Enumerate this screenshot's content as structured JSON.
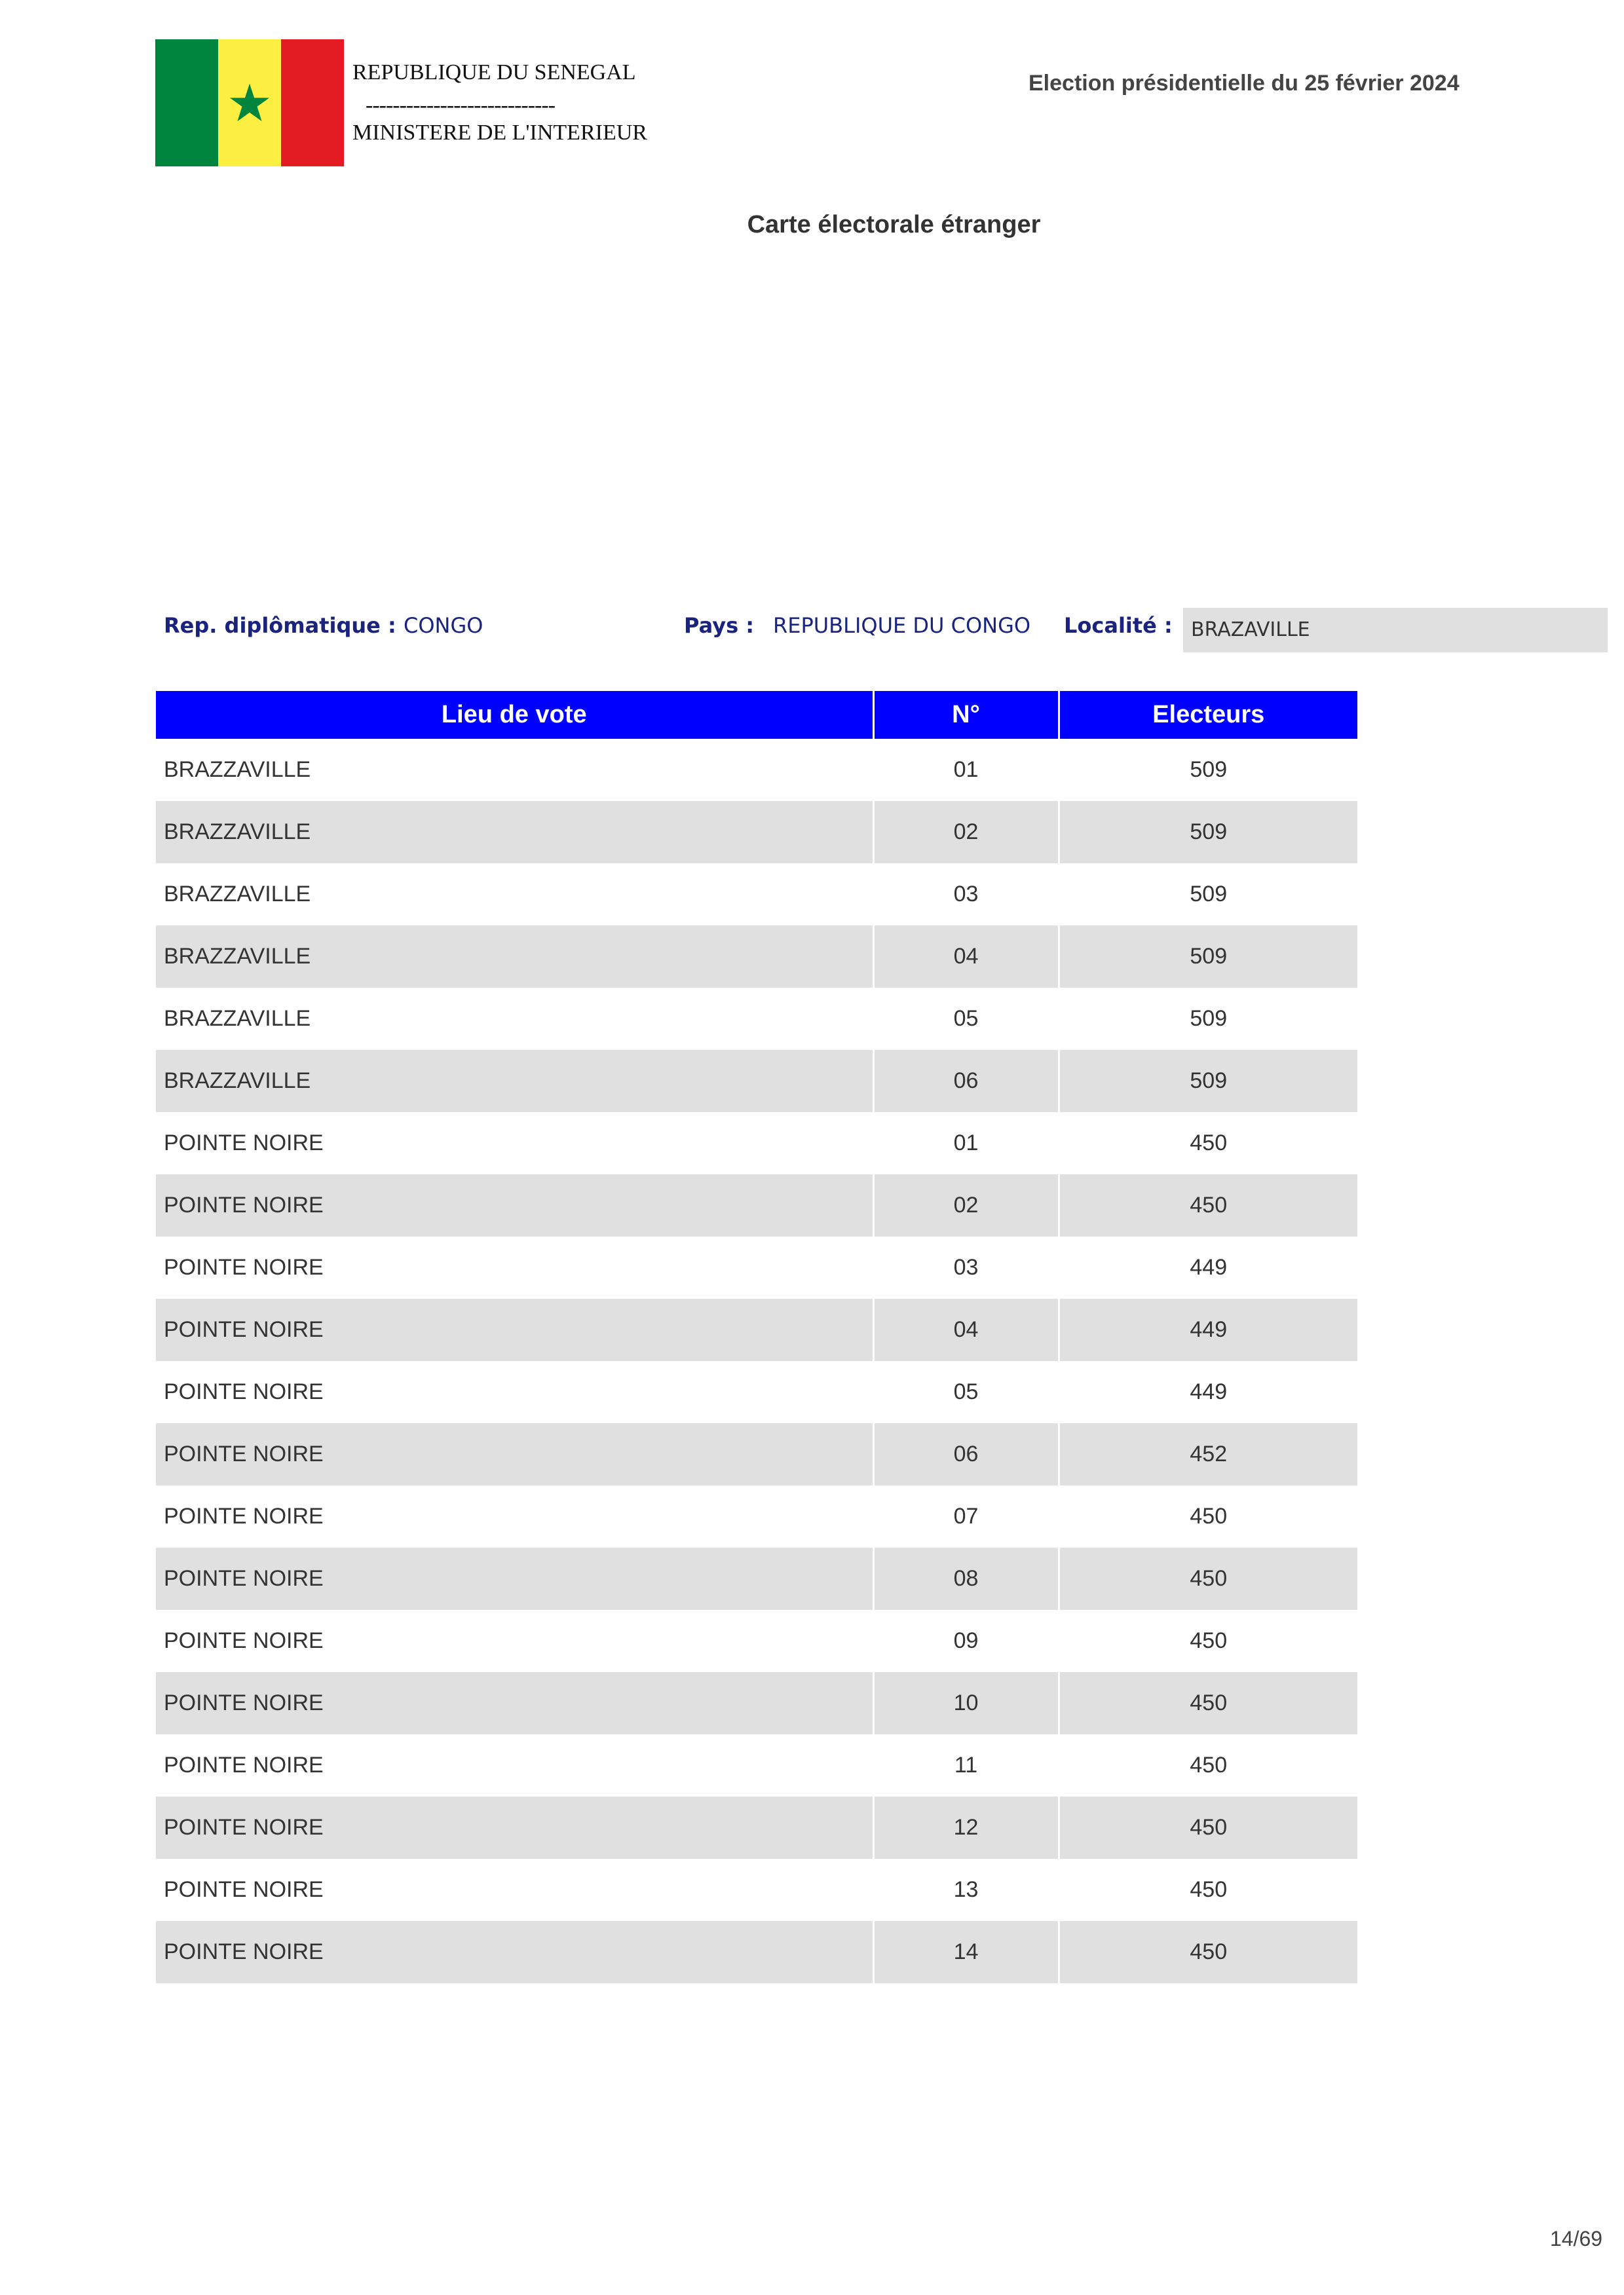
{
  "header": {
    "republic": "REPUBLIQUE DU SENEGAL",
    "separator": "----------------------------",
    "ministry": "MINISTERE DE L'INTERIEUR",
    "election": "Election présidentielle du 25 février 2024",
    "flag_colors": [
      "#00853f",
      "#fdef42",
      "#e31b23"
    ]
  },
  "document_title": "Carte électorale étranger",
  "info": {
    "rep_label": "Rep. diplômatique :",
    "rep_value": "CONGO",
    "pays_label": "Pays :",
    "pays_value": "REPUBLIQUE DU CONGO",
    "localite_label": "Localité :",
    "localite_value": "BRAZAVILLE"
  },
  "table": {
    "headers": [
      "Lieu de vote",
      "N°",
      "Electeurs"
    ],
    "rows": [
      {
        "lieu": "BRAZZAVILLE",
        "num": "01",
        "electeurs": "509"
      },
      {
        "lieu": "BRAZZAVILLE",
        "num": "02",
        "electeurs": "509"
      },
      {
        "lieu": "BRAZZAVILLE",
        "num": "03",
        "electeurs": "509"
      },
      {
        "lieu": "BRAZZAVILLE",
        "num": "04",
        "electeurs": "509"
      },
      {
        "lieu": "BRAZZAVILLE",
        "num": "05",
        "electeurs": "509"
      },
      {
        "lieu": "BRAZZAVILLE",
        "num": "06",
        "electeurs": "509"
      },
      {
        "lieu": "POINTE NOIRE",
        "num": "01",
        "electeurs": "450"
      },
      {
        "lieu": "POINTE NOIRE",
        "num": "02",
        "electeurs": "450"
      },
      {
        "lieu": "POINTE NOIRE",
        "num": "03",
        "electeurs": "449"
      },
      {
        "lieu": "POINTE NOIRE",
        "num": "04",
        "electeurs": "449"
      },
      {
        "lieu": "POINTE NOIRE",
        "num": "05",
        "electeurs": "449"
      },
      {
        "lieu": "POINTE NOIRE",
        "num": "06",
        "electeurs": "452"
      },
      {
        "lieu": "POINTE NOIRE",
        "num": "07",
        "electeurs": "450"
      },
      {
        "lieu": "POINTE NOIRE",
        "num": "08",
        "electeurs": "450"
      },
      {
        "lieu": "POINTE NOIRE",
        "num": "09",
        "electeurs": "450"
      },
      {
        "lieu": "POINTE NOIRE",
        "num": "10",
        "electeurs": "450"
      },
      {
        "lieu": "POINTE NOIRE",
        "num": "11",
        "electeurs": "450"
      },
      {
        "lieu": "POINTE NOIRE",
        "num": "12",
        "electeurs": "450"
      },
      {
        "lieu": "POINTE NOIRE",
        "num": "13",
        "electeurs": "450"
      },
      {
        "lieu": "POINTE NOIRE",
        "num": "14",
        "electeurs": "450"
      }
    ]
  },
  "page_number": "14/69"
}
